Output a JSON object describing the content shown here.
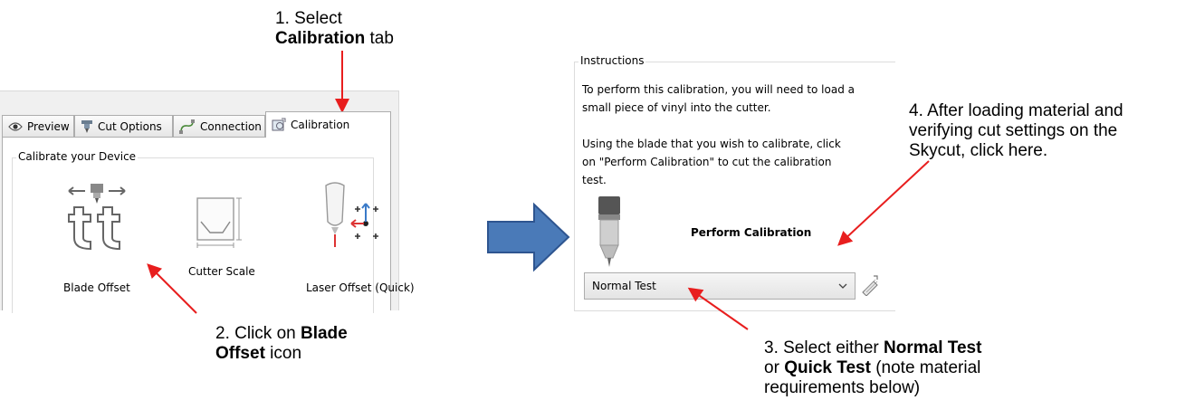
{
  "annotations": {
    "step1_line1": "1. Select",
    "step1_bold": "Calibration",
    "step1_rest": " tab",
    "step2_line1_a": "2. Click on ",
    "step2_line1_bold": "Blade",
    "step2_line2_bold": "Offset",
    "step2_line2_rest": " icon",
    "step3_line1_a": "3. Select either ",
    "step3_line1_bold": "Normal Test",
    "step3_line2_a": "or ",
    "step3_line2_bold": "Quick Test",
    "step3_line2_rest": " (note material",
    "step3_line3": "requirements below)",
    "step4_line1": "4. After loading material and",
    "step4_line2": "verifying cut settings on the",
    "step4_line3": "Skycut, click here."
  },
  "tabs": [
    {
      "label": "Preview",
      "icon": "eye-icon"
    },
    {
      "label": "Cut Options",
      "icon": "blade-icon"
    },
    {
      "label": "Connection",
      "icon": "cable-icon"
    },
    {
      "label": "Calibration",
      "icon": "calibration-icon",
      "active": true
    }
  ],
  "calibration_group": {
    "label": "Calibrate your Device",
    "items": [
      {
        "label": "Blade Offset",
        "icon": "blade-offset-icon"
      },
      {
        "label": "Cutter Scale",
        "icon": "cutter-scale-icon"
      },
      {
        "label": "Laser Offset (Quick)",
        "icon": "laser-offset-icon"
      }
    ]
  },
  "instructions": {
    "label": "Instructions",
    "paragraph1_line1": "To perform this calibration, you will need to load a",
    "paragraph1_line2": "small piece of vinyl into the cutter.",
    "paragraph2_line1": "Using the blade that you wish to calibrate,  click",
    "paragraph2_line2": "on \"Perform Calibration\" to cut the calibration",
    "paragraph2_line3": "test.",
    "perform_button_label": "Perform Calibration",
    "test_select_value": "Normal Test"
  },
  "colors": {
    "arrow_red": "#e81e1e",
    "big_arrow_fill": "#4a7ab8",
    "big_arrow_stroke": "#2e5590",
    "panel_bg": "#f0f0f0"
  }
}
